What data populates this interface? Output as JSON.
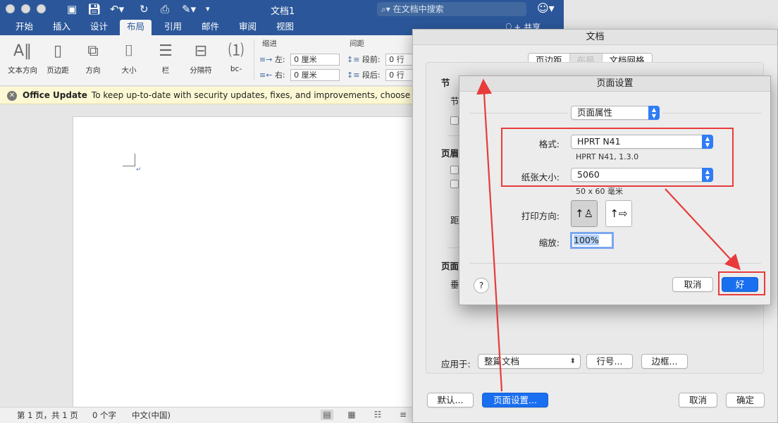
{
  "window": {
    "title": "文档1",
    "search_placeholder": "在文档中搜索",
    "share_label": "共享"
  },
  "tabs": [
    {
      "label": "开始"
    },
    {
      "label": "插入"
    },
    {
      "label": "设计"
    },
    {
      "label": "布局"
    },
    {
      "label": "引用"
    },
    {
      "label": "邮件"
    },
    {
      "label": "审阅"
    },
    {
      "label": "视图"
    }
  ],
  "ribbon": {
    "buttons": [
      {
        "label": "文本方向"
      },
      {
        "label": "页边距"
      },
      {
        "label": "方向"
      },
      {
        "label": "大小"
      },
      {
        "label": "栏"
      },
      {
        "label": "分隔符"
      }
    ],
    "indent": {
      "title": "缩进",
      "left_label": "左:",
      "left_value": "0 厘米",
      "right_label": "右:",
      "right_value": "0 厘米"
    },
    "spacing": {
      "title": "间距",
      "before_label": "段前:",
      "before_value": "0 行",
      "after_label": "段后:",
      "after_value": "0 行"
    }
  },
  "update_bar": {
    "title": "Office Update",
    "message": "To keep up-to-date with security updates, fixes, and improvements, choose Check for U"
  },
  "statusbar": {
    "page": "第 1 页，共 1 页",
    "words": "0 个字",
    "language": "中文(中国)"
  },
  "doc_dialog": {
    "title": "文档",
    "segments": [
      {
        "label": "页边距"
      },
      {
        "label": "布局"
      },
      {
        "label": "文档网格"
      }
    ],
    "fragments": {
      "section": "节",
      "section_sub": "节",
      "header": "页眉",
      "distance": "距",
      "page": "页面",
      "vertical": "垂"
    },
    "apply_label": "应用于:",
    "apply_value": "整篇文档",
    "line_numbers_button": "行号...",
    "borders_button": "边框...",
    "default_button": "默认...",
    "page_setup_button": "页面设置...",
    "cancel_button": "取消",
    "ok_button": "确定"
  },
  "page_setup": {
    "title": "页面设置",
    "settings_popup": "页面属性",
    "format_label": "格式:",
    "format_value": "HPRT N41",
    "format_sub": "HPRT N41, 1.3.0",
    "paper_label": "纸张大小:",
    "paper_value": "5060",
    "paper_sub": "50 x 60 毫米",
    "orientation_label": "打印方向:",
    "scale_label": "缩放:",
    "scale_value": "100%",
    "help": "?",
    "cancel_button": "取消",
    "ok_button": "好"
  },
  "colors": {
    "word_blue": "#2b579a",
    "accent_blue": "#1a6ff0",
    "annotation_red": "#e83b3b"
  }
}
